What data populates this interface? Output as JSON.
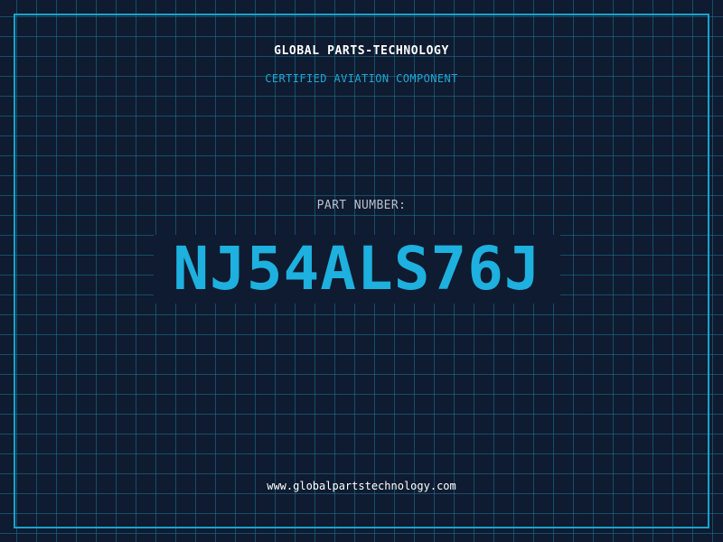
{
  "header": {
    "company_name": "GLOBAL PARTS-TECHNOLOGY",
    "subtitle": "CERTIFIED AVIATION COMPONENT"
  },
  "part": {
    "label": "PART NUMBER:",
    "number": "NJ54ALS76J"
  },
  "footer": {
    "website": "www.globalpartstechnology.com"
  },
  "colors": {
    "background": "#0f1b30",
    "grid": "#1c7896",
    "accent": "#1eb0de",
    "frame": "#1aa3cc",
    "label": "#b7c0cc",
    "text": "#ffffff"
  }
}
